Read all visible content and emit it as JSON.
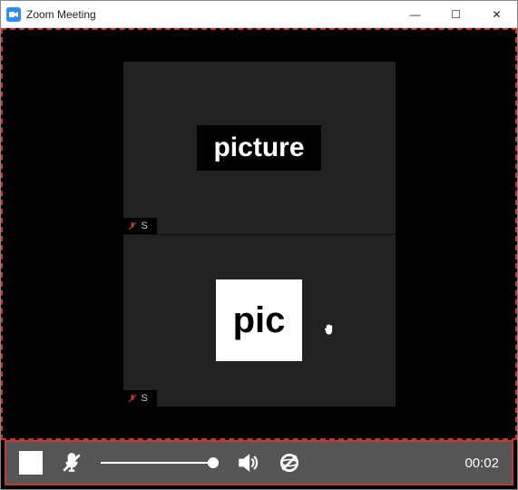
{
  "window": {
    "title": "Zoom Meeting"
  },
  "participants": [
    {
      "name_visible": "S",
      "thumb_label": "picture",
      "muted": true
    },
    {
      "name_visible": "S",
      "thumb_label": "pic",
      "muted": true,
      "hand_raised": true
    }
  ],
  "player": {
    "timer": "00:02"
  },
  "icons": {
    "minimize": "—",
    "maximize": "☐",
    "close": "✕",
    "hand": "✋"
  }
}
